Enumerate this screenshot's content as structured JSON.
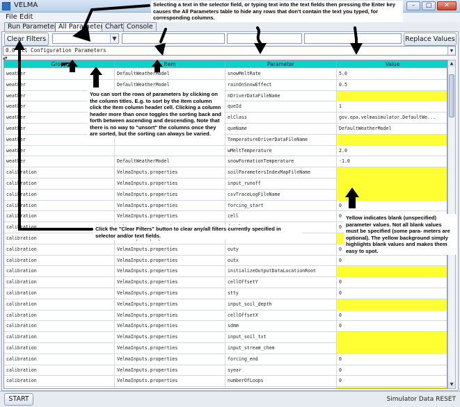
{
  "window": {
    "title": "VELMA"
  },
  "menu": [
    "File",
    "Edit"
  ],
  "tabs": [
    "Run Parameters",
    "All Parameters",
    "Chart",
    "Console"
  ],
  "toolbar": {
    "clear_filters": "Clear Filters",
    "replace_values": "Replace Values"
  },
  "filter_combo": {
    "value": "0.0   All Configuration Parameters"
  },
  "table": {
    "columns": [
      "Group",
      "Item",
      "Parameter",
      "Value"
    ],
    "rows": [
      [
        "weather",
        "DefaultWeatherModel",
        "snowMeltRate",
        "5.0"
      ],
      [
        "weather",
        "DefaultWeatherModel",
        "rainOnSnowEffect",
        "0.5"
      ],
      [
        "weather",
        "",
        "nDriverDataFileName",
        ""
      ],
      [
        "weather",
        "",
        "queId",
        "1"
      ],
      [
        "weather",
        "",
        "elClass",
        "gov.epa.velmasimulator.DefaultWe..."
      ],
      [
        "weather",
        "",
        "queName",
        "DefaultWeatherModel"
      ],
      [
        "weather",
        "",
        "TemperatureDriverDataFileName",
        ""
      ],
      [
        "weather",
        "",
        "wMeltTemperature",
        "2.0"
      ],
      [
        "weather",
        "DefaultWeatherModel",
        "snowFormationTemperature",
        "-1.0"
      ],
      [
        "calibration",
        "VelmaInputs.properties",
        "soilParametersIndexMapFileName",
        ""
      ],
      [
        "calibration",
        "VelmaInputs.properties",
        "input_runoff",
        ""
      ],
      [
        "calibration",
        "VelmaInputs.properties",
        "csvTraceLogFileName",
        ""
      ],
      [
        "calibration",
        "VelmaInputs.properties",
        "forcing_start",
        "0"
      ],
      [
        "calibration",
        "VelmaInputs.properties",
        "cell",
        "0"
      ],
      [
        "calibration",
        "VelmaInputs.properties",
        "f_ksl",
        "0"
      ],
      [
        "calibration",
        "VelmaInputs.properties",
        "ulationFileName",
        ""
      ],
      [
        "calibration",
        "VelmaInputs.properties",
        "outy",
        "0"
      ],
      [
        "calibration",
        "VelmaInputs.properties",
        "outx",
        "0"
      ],
      [
        "calibration",
        "VelmaInputs.properties",
        "initializeOutputDataLocationRoot",
        ""
      ],
      [
        "calibration",
        "VelmaInputs.properties",
        "cellOffsetY",
        "0"
      ],
      [
        "calibration",
        "VelmaInputs.properties",
        "stty",
        "0"
      ],
      [
        "calibration",
        "VelmaInputs.properties",
        "input_soil_depth",
        ""
      ],
      [
        "calibration",
        "VelmaInputs.properties",
        "cellOffsetX",
        "0"
      ],
      [
        "calibration",
        "VelmaInputs.properties",
        "sdmm",
        "0"
      ],
      [
        "calibration",
        "VelmaInputs.properties",
        "input_soil_txt",
        ""
      ],
      [
        "calibration",
        "VelmaInputs.properties",
        "input_stream_chem",
        ""
      ],
      [
        "calibration",
        "VelmaInputs.properties",
        "forcing_end",
        "0"
      ],
      [
        "calibration",
        "VelmaInputs.properties",
        "syear",
        "0"
      ],
      [
        "calibration",
        "VelmaInputs.properties",
        "numberOfLoops",
        "0"
      ],
      [
        "calibration",
        "VelmaInputs.properties",
        "flowDirectionFileName",
        ""
      ]
    ]
  },
  "status": {
    "start_button": "START",
    "message": "Simulator Data RESET"
  },
  "annotations": {
    "selector_note": "Selecting a text in the selector field, or typing text into the text fields then pressing the Enter key causes the All Parameters table to hide any rows that don't contain the text you typed, for corresponding columns.",
    "sort_note": "You can sort the rows of parameters by clicking on the column titles.  E.g. to sort by the Item column click the Item column header cell. Clicking a column header more than once toggles the sorting back and forth between ascending and descending.  Note that there is no way to \"unsort\" the columns once they are sorted, but the sorting can always be varied.",
    "clear_note": "Click the \"Clear Filters\" button to clear any/all filters currently specified in selector and/or text fields.",
    "yellow_note": "Yellow indicates blank (unspecified) parameter values.  Not all blank values must be specified (some para- meters are optional).  The yellow background simply highlights blank values and makes them easy to spot."
  }
}
